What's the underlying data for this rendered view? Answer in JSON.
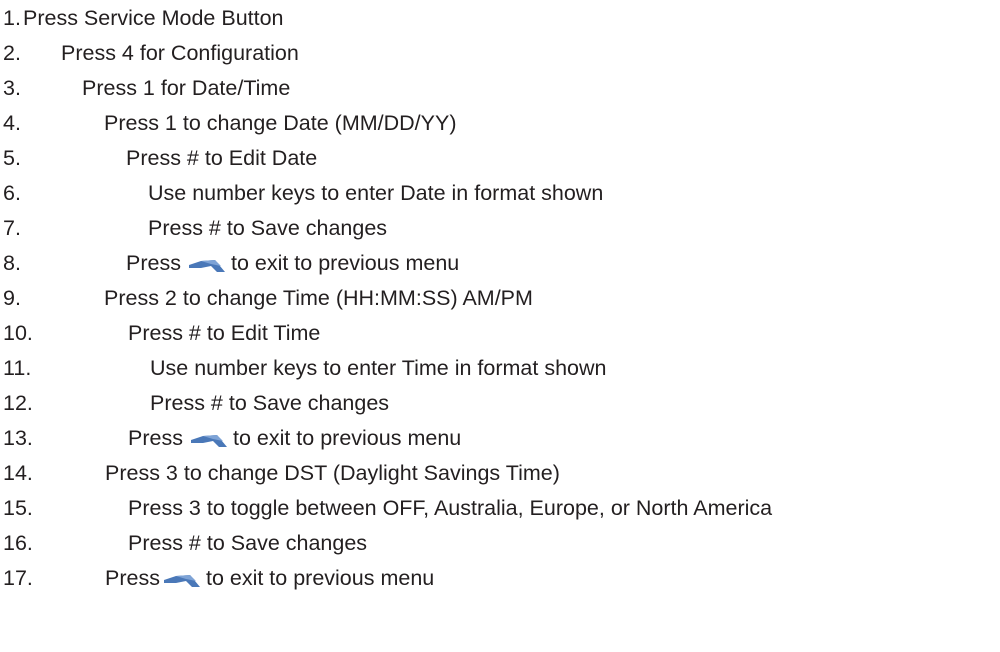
{
  "steps": [
    {
      "number": "1.",
      "text": "Press Service Mode Button"
    },
    {
      "number": "2.",
      "text": "Press 4 for Configuration"
    },
    {
      "number": "3.",
      "text": "Press 1 for Date/Time"
    },
    {
      "number": "4.",
      "text": "Press 1 to change Date (MM/DD/YY)"
    },
    {
      "number": "5.",
      "text": "Press # to Edit Date"
    },
    {
      "number": "6.",
      "text": "Use number keys to enter Date in format shown"
    },
    {
      "number": "7.",
      "text": "Press # to Save changes"
    },
    {
      "number": "8.",
      "before": "Press",
      "after": "to exit to previous menu",
      "icon": "back-arrow-icon"
    },
    {
      "number": "9.",
      "text": "Press 2 to change Time (HH:MM:SS) AM/PM"
    },
    {
      "number": "10.",
      "text": "Press # to Edit Time"
    },
    {
      "number": "11.",
      "text": "Use number keys to enter Time in format shown"
    },
    {
      "number": "12.",
      "text": "Press # to Save changes"
    },
    {
      "number": "13.",
      "before": "Press",
      "after": "to exit to previous menu",
      "icon": "back-arrow-icon"
    },
    {
      "number": "14.",
      "text": "Press 3 to change DST (Daylight Savings Time)"
    },
    {
      "number": "15.",
      "text": "Press 3 to toggle between OFF, Australia, Europe, or North America"
    },
    {
      "number": "16.",
      "text": "Press # to Save changes"
    },
    {
      "number": "17.",
      "before": "Press",
      "after": "to exit to previous menu",
      "icon": "back-arrow-icon"
    }
  ],
  "colors": {
    "text": "#231f20",
    "arrow": "#4a78b8"
  }
}
